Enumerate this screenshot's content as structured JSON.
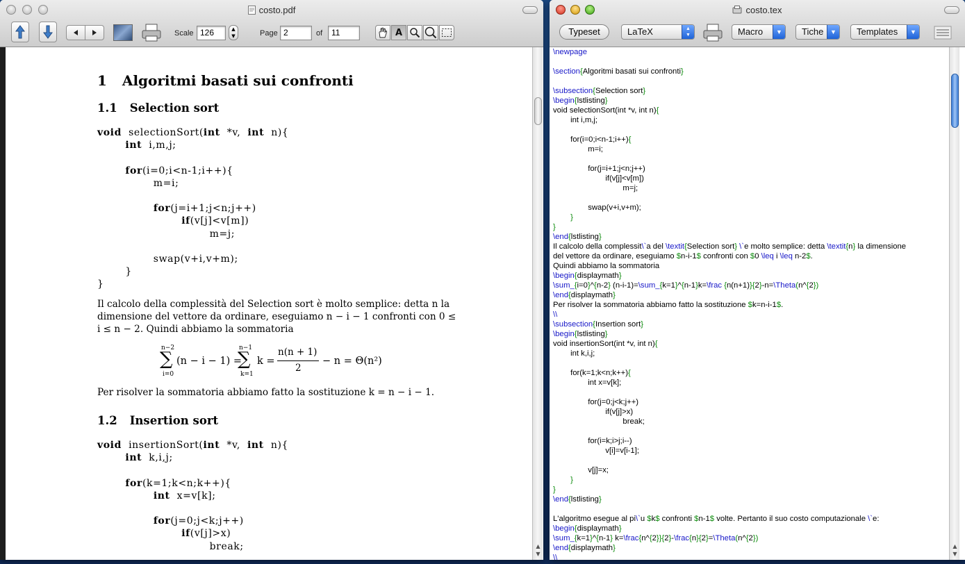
{
  "pdf_window": {
    "title": "costo.pdf",
    "scale_label": "Scale",
    "scale_value": "126",
    "page_label": "Page",
    "page_value": "2",
    "of_label": "of",
    "total_pages": "11"
  },
  "pdf_content": {
    "section_num": "1",
    "section_title": "Algoritmi basati sui confronti",
    "sub1_num": "1.1",
    "sub1_title": "Selection sort",
    "code1": [
      "void  selectionSort(int  *v,  int  n){",
      "        int  i,m,j;",
      "",
      "        for(i=0;i<n-1;i++){",
      "                m=i;",
      "",
      "                for(j=i+1;j<n;j++)",
      "                        if(v[j]<v[m])",
      "                                m=j;",
      "",
      "                swap(v+i,v+m);",
      "        }",
      "}"
    ],
    "para1_line1": "Il calcolo della complessità del Selection sort è molto semplice: detta n la",
    "para1_line2": "dimensione del vettore da ordinare, eseguiamo n − i − 1 confronti con 0 ≤",
    "para1_line3": "i ≤ n − 2. Quindi abbiamo la sommatoria",
    "formula_lhs_sum_top": "n−2",
    "formula_lhs_sum_bottom": "i=0",
    "formula_lhs_body": "(n − i − 1) =",
    "formula_rhs_sum_top": "n−1",
    "formula_rhs_sum_bottom": "k=1",
    "formula_rhs_k": "k =",
    "formula_frac_num": "n(n + 1)",
    "formula_frac_den": "2",
    "formula_tail": "− n = Θ(n²)",
    "para2": "Per risolver la sommatoria abbiamo fatto la sostituzione k = n − i − 1.",
    "sub2_num": "1.2",
    "sub2_title": "Insertion sort",
    "code2": [
      "void  insertionSort(int  *v,  int  n){",
      "        int  k,i,j;",
      "",
      "        for(k=1;k<n;k++){",
      "                int  x=v[k];",
      "",
      "                for(j=0;j<k;j++)",
      "                        if(v[j]>x)",
      "                                break;"
    ]
  },
  "tex_window": {
    "title": "costo.tex",
    "typeset_label": "Typeset",
    "engine_value": "LaTeX",
    "macro_label": "Macro",
    "tags_label": "Tiche",
    "templates_label": "Templates"
  },
  "tex_source": [
    [
      [
        "c",
        "\\newpage"
      ]
    ],
    [],
    [
      [
        "c",
        "\\section"
      ],
      [
        "g",
        "{"
      ],
      [
        "t",
        "Algoritmi basati sui confronti"
      ],
      [
        "g",
        "}"
      ]
    ],
    [],
    [
      [
        "c",
        "\\subsection"
      ],
      [
        "g",
        "{"
      ],
      [
        "t",
        "Selection sort"
      ],
      [
        "g",
        "}"
      ]
    ],
    [
      [
        "c",
        "\\begin"
      ],
      [
        "g",
        "{"
      ],
      [
        "t",
        "lstlisting"
      ],
      [
        "g",
        "}"
      ]
    ],
    [
      [
        "t",
        "void selectionSort(int *v, int n)"
      ],
      [
        "g",
        "{"
      ]
    ],
    [
      [
        "t",
        "        int i,m,j;"
      ]
    ],
    [],
    [
      [
        "t",
        "        for(i=0;i<n-1;i++)"
      ],
      [
        "g",
        "{"
      ]
    ],
    [
      [
        "t",
        "                m=i;"
      ]
    ],
    [],
    [
      [
        "t",
        "                for(j=i+1;j<n;j++)"
      ]
    ],
    [
      [
        "t",
        "                        if(v[j]<v[m])"
      ]
    ],
    [
      [
        "t",
        "                                m=j;"
      ]
    ],
    [],
    [
      [
        "t",
        "                swap(v+i,v+m);"
      ]
    ],
    [
      [
        "g",
        "        }"
      ]
    ],
    [
      [
        "g",
        "}"
      ]
    ],
    [
      [
        "c",
        "\\end"
      ],
      [
        "g",
        "{"
      ],
      [
        "t",
        "lstlisting"
      ],
      [
        "g",
        "}"
      ]
    ],
    [
      [
        "t",
        "Il calcolo della complessit"
      ],
      [
        "c",
        "\\`"
      ],
      [
        "t",
        "a del "
      ],
      [
        "c",
        "\\textit"
      ],
      [
        "g",
        "{"
      ],
      [
        "t",
        "Selection sort"
      ],
      [
        "g",
        "}"
      ],
      [
        "t",
        " "
      ],
      [
        "c",
        "\\`"
      ],
      [
        "t",
        "e molto semplice: detta "
      ],
      [
        "c",
        "\\textit"
      ],
      [
        "g",
        "{"
      ],
      [
        "t",
        "n"
      ],
      [
        "g",
        "}"
      ],
      [
        "t",
        " la dimensione"
      ]
    ],
    [
      [
        "t",
        "del vettore da ordinare, eseguiamo "
      ],
      [
        "g",
        "$"
      ],
      [
        "t",
        "n-i-1"
      ],
      [
        "g",
        "$"
      ],
      [
        "t",
        " confronti con "
      ],
      [
        "g",
        "$"
      ],
      [
        "t",
        "0 "
      ],
      [
        "c",
        "\\leq"
      ],
      [
        "t",
        " i "
      ],
      [
        "c",
        "\\leq"
      ],
      [
        "t",
        " n-2"
      ],
      [
        "g",
        "$"
      ],
      [
        "t",
        "."
      ]
    ],
    [
      [
        "t",
        "Quindi abbiamo la sommatoria"
      ]
    ],
    [
      [
        "c",
        "\\begin"
      ],
      [
        "g",
        "{"
      ],
      [
        "t",
        "displaymath"
      ],
      [
        "g",
        "}"
      ]
    ],
    [
      [
        "c",
        "\\sum_"
      ],
      [
        "g",
        "{"
      ],
      [
        "t",
        "i=0"
      ],
      [
        "g",
        "}"
      ],
      [
        "t",
        "^"
      ],
      [
        "g",
        "{"
      ],
      [
        "t",
        "n-2"
      ],
      [
        "g",
        "}"
      ],
      [
        "t",
        " (n-i-1)="
      ],
      [
        "c",
        "\\sum_"
      ],
      [
        "g",
        "{"
      ],
      [
        "t",
        "k=1"
      ],
      [
        "g",
        "}"
      ],
      [
        "t",
        "^"
      ],
      [
        "g",
        "{"
      ],
      [
        "t",
        "n-1"
      ],
      [
        "g",
        "}"
      ],
      [
        "t",
        "k="
      ],
      [
        "c",
        "\\frac"
      ],
      [
        "t",
        " "
      ],
      [
        "g",
        "{"
      ],
      [
        "t",
        "n(n+1)"
      ],
      [
        "g",
        "}{"
      ],
      [
        "t",
        "2"
      ],
      [
        "g",
        "}"
      ],
      [
        "t",
        "-n="
      ],
      [
        "c",
        "\\Theta"
      ],
      [
        "g",
        "("
      ],
      [
        "t",
        "n^"
      ],
      [
        "g",
        "{"
      ],
      [
        "t",
        "2"
      ],
      [
        "g",
        "})"
      ]
    ],
    [
      [
        "c",
        "\\end"
      ],
      [
        "g",
        "{"
      ],
      [
        "t",
        "displaymath"
      ],
      [
        "g",
        "}"
      ]
    ],
    [
      [
        "t",
        "Per risolver la sommatoria abbiamo fatto la sostituzione "
      ],
      [
        "g",
        "$"
      ],
      [
        "t",
        "k=n-i-1"
      ],
      [
        "g",
        "$"
      ],
      [
        "t",
        "."
      ]
    ],
    [
      [
        "c",
        "\\\\"
      ]
    ],
    [
      [
        "c",
        "\\subsection"
      ],
      [
        "g",
        "{"
      ],
      [
        "t",
        "Insertion sort"
      ],
      [
        "g",
        "}"
      ]
    ],
    [
      [
        "c",
        "\\begin"
      ],
      [
        "g",
        "{"
      ],
      [
        "t",
        "lstlisting"
      ],
      [
        "g",
        "}"
      ]
    ],
    [
      [
        "t",
        "void insertionSort(int *v, int n)"
      ],
      [
        "g",
        "{"
      ]
    ],
    [
      [
        "t",
        "        int k,i,j;"
      ]
    ],
    [],
    [
      [
        "t",
        "        for(k=1;k<n;k++)"
      ],
      [
        "g",
        "{"
      ]
    ],
    [
      [
        "t",
        "                int x=v[k];"
      ]
    ],
    [],
    [
      [
        "t",
        "                for(j=0;j<k;j++)"
      ]
    ],
    [
      [
        "t",
        "                        if(v[j]>x)"
      ]
    ],
    [
      [
        "t",
        "                                break;"
      ]
    ],
    [],
    [
      [
        "t",
        "                for(i=k;i>j;i--)"
      ]
    ],
    [
      [
        "t",
        "                        v[i]=v[i-1];"
      ]
    ],
    [],
    [
      [
        "t",
        "                v[j]=x;"
      ]
    ],
    [
      [
        "g",
        "        }"
      ]
    ],
    [
      [
        "g",
        "}"
      ]
    ],
    [
      [
        "c",
        "\\end"
      ],
      [
        "g",
        "{"
      ],
      [
        "t",
        "lstlisting"
      ],
      [
        "g",
        "}"
      ]
    ],
    [],
    [
      [
        "t",
        "L'algoritmo esegue al pi"
      ],
      [
        "c",
        "\\`"
      ],
      [
        "t",
        "u "
      ],
      [
        "g",
        "$"
      ],
      [
        "t",
        "k"
      ],
      [
        "g",
        "$"
      ],
      [
        "t",
        " confronti "
      ],
      [
        "g",
        "$"
      ],
      [
        "t",
        "n-1"
      ],
      [
        "g",
        "$"
      ],
      [
        "t",
        " volte. Pertanto il suo costo computazionale "
      ],
      [
        "c",
        "\\`"
      ],
      [
        "t",
        "e:"
      ]
    ],
    [
      [
        "c",
        "\\begin"
      ],
      [
        "g",
        "{"
      ],
      [
        "t",
        "displaymath"
      ],
      [
        "g",
        "}"
      ]
    ],
    [
      [
        "c",
        "\\sum_"
      ],
      [
        "g",
        "{"
      ],
      [
        "t",
        "k=1"
      ],
      [
        "g",
        "}"
      ],
      [
        "t",
        "^"
      ],
      [
        "g",
        "{"
      ],
      [
        "t",
        "n-1"
      ],
      [
        "g",
        "}"
      ],
      [
        "t",
        " k="
      ],
      [
        "c",
        "\\frac"
      ],
      [
        "g",
        "{"
      ],
      [
        "t",
        "n^"
      ],
      [
        "g",
        "{"
      ],
      [
        "t",
        "2"
      ],
      [
        "g",
        "}}{"
      ],
      [
        "t",
        "2"
      ],
      [
        "g",
        "}"
      ],
      [
        "t",
        "-"
      ],
      [
        "c",
        "\\frac"
      ],
      [
        "g",
        "{"
      ],
      [
        "t",
        "n"
      ],
      [
        "g",
        "}{"
      ],
      [
        "t",
        "2"
      ],
      [
        "g",
        "}"
      ],
      [
        "t",
        "="
      ],
      [
        "c",
        "\\Theta"
      ],
      [
        "g",
        "("
      ],
      [
        "t",
        "n^"
      ],
      [
        "g",
        "{"
      ],
      [
        "t",
        "2"
      ],
      [
        "g",
        "})"
      ]
    ],
    [
      [
        "c",
        "\\end"
      ],
      [
        "g",
        "{"
      ],
      [
        "t",
        "displaymath"
      ],
      [
        "g",
        "}"
      ]
    ],
    [
      [
        "c",
        "\\\\"
      ]
    ]
  ],
  "icons": [
    "page-up-arrow-icon",
    "page-down-arrow-icon",
    "prev-next-icon",
    "picture-icon",
    "printer-icon",
    "hand-tool-icon",
    "text-tool-icon",
    "zoom-in-icon",
    "zoom-out-icon",
    "select-tool-icon",
    "pdf-file-icon",
    "tex-file-icon",
    "toolbar-toggle-icon"
  ],
  "colors": {
    "command": "#1717c8",
    "brace": "#0b8a0b",
    "desktop": "#17386b"
  }
}
